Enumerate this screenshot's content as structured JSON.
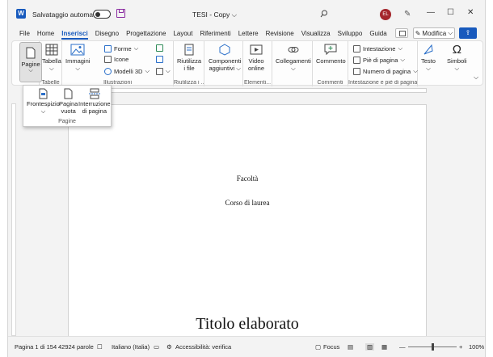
{
  "titlebar": {
    "logo_letter": "W",
    "autosave_label": "Salvataggio automatico",
    "document_title": "TESI - Copy",
    "avatar_initials": "EL",
    "accent": "#185abd"
  },
  "tabs": [
    "File",
    "Home",
    "Inserisci",
    "Disegno",
    "Progettazione",
    "Layout",
    "Riferimenti",
    "Lettere",
    "Revisione",
    "Visualizza",
    "Sviluppo",
    "Guida"
  ],
  "active_tab": "Inserisci",
  "toolbar": {
    "modifica_label": "Modifica"
  },
  "ribbon": {
    "pagine": "Pagine",
    "tabella": "Tabella",
    "tabelle_group": "Tabelle",
    "immagini": "Immagini",
    "forme": "Forme",
    "icone": "Icone",
    "modelli3d": "Modelli 3D",
    "illustrazioni_group": "Illustrazioni",
    "riutilizza_1": "Riutilizza",
    "riutilizza_2": "i file",
    "riutilizza_group": "Riutilizza i ...",
    "componenti_1": "Componenti",
    "componenti_2": "aggiuntivi",
    "video_1": "Video",
    "video_2": "online",
    "elementi_group": "Elementi...",
    "collegamenti": "Collegamenti",
    "commento": "Commento",
    "commenti_group": "Commenti",
    "intestazione": "Intestazione",
    "pie_di_pagina": "Piè di pagina",
    "numero_di_pagina": "Numero di pagina",
    "intestazione_group": "Intestazione e piè di pagina",
    "testo": "Testo",
    "simboli": "Simboli"
  },
  "dropdown": {
    "frontespizio": "Frontespizio",
    "pagina_vuota_1": "Pagina",
    "pagina_vuota_2": "vuota",
    "interruzione_1": "Interruzione",
    "interruzione_2": "di pagina",
    "group_label": "Pagine"
  },
  "document": {
    "line1": "Facoltà",
    "line2": "Corso di laurea",
    "title": "Titolo elaborato"
  },
  "statusbar": {
    "page": "Pagina 1 di 154",
    "words": "42924 parole",
    "language": "Italiano (Italia)",
    "accessibility": "Accessibilità: verifica",
    "focus": "Focus",
    "zoom": "100%"
  }
}
